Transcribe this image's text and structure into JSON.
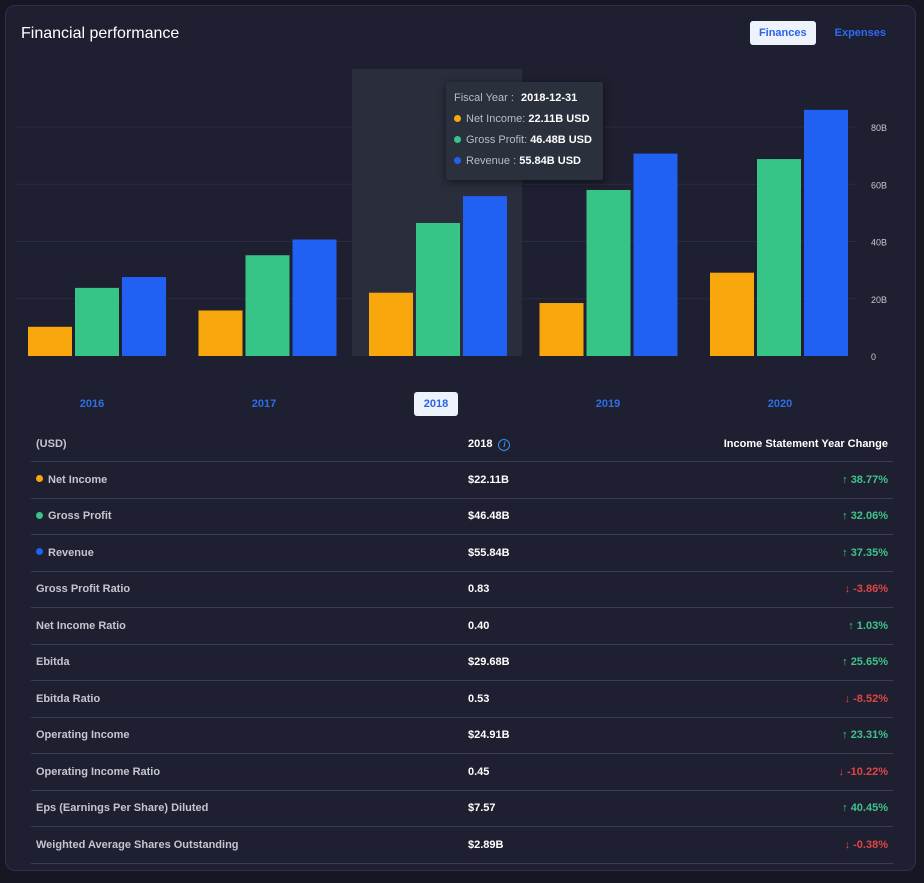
{
  "header": {
    "title": "Financial performance",
    "tabs": [
      "Finances",
      "Expenses"
    ]
  },
  "colors": {
    "net_income": "#f8a80d",
    "gross_profit": "#37c587",
    "revenue": "#2060f2"
  },
  "chart_data": {
    "type": "bar",
    "categories": [
      "2016",
      "2017",
      "2018",
      "2019",
      "2020"
    ],
    "series": [
      {
        "name": "Net Income",
        "values": [
          10.2,
          15.9,
          22.11,
          18.5,
          29.1
        ]
      },
      {
        "name": "Gross Profit",
        "values": [
          23.8,
          35.2,
          46.48,
          58.0,
          68.8
        ]
      },
      {
        "name": "Revenue",
        "values": [
          27.6,
          40.7,
          55.84,
          70.7,
          86.0
        ]
      }
    ],
    "yticks": [
      "0",
      "20B",
      "40B",
      "60B",
      "80B"
    ],
    "ylim": [
      0,
      90
    ],
    "highlighted": "2018"
  },
  "tooltip": {
    "fiscal_label": "Fiscal Year :",
    "fiscal_value": "2018-12-31",
    "rows": [
      {
        "label": "Net Income:",
        "value": "22.11B USD"
      },
      {
        "label": "Gross Profit:",
        "value": "46.48B USD"
      },
      {
        "label": "Revenue :",
        "value": "55.84B USD"
      }
    ]
  },
  "table": {
    "headers": {
      "unit": "(USD)",
      "year": "2018",
      "change": "Income Statement Year Change"
    },
    "rows": [
      {
        "label": "Net Income",
        "value": "$22.11B",
        "change": "38.77%",
        "dir": "up",
        "dot": "#f8a80d"
      },
      {
        "label": "Gross Profit",
        "value": "$46.48B",
        "change": "32.06%",
        "dir": "up",
        "dot": "#37c587"
      },
      {
        "label": "Revenue",
        "value": "$55.84B",
        "change": "37.35%",
        "dir": "up",
        "dot": "#2060f2"
      },
      {
        "label": "Gross Profit Ratio",
        "value": "0.83",
        "change": "-3.86%",
        "dir": "down"
      },
      {
        "label": "Net Income Ratio",
        "value": "0.40",
        "change": "1.03%",
        "dir": "up"
      },
      {
        "label": "Ebitda",
        "value": "$29.68B",
        "change": "25.65%",
        "dir": "up"
      },
      {
        "label": "Ebitda Ratio",
        "value": "0.53",
        "change": "-8.52%",
        "dir": "down"
      },
      {
        "label": "Operating Income",
        "value": "$24.91B",
        "change": "23.31%",
        "dir": "up"
      },
      {
        "label": "Operating Income Ratio",
        "value": "0.45",
        "change": "-10.22%",
        "dir": "down"
      },
      {
        "label": "Eps (Earnings Per Share) Diluted",
        "value": "$7.57",
        "change": "40.45%",
        "dir": "up"
      },
      {
        "label": "Weighted Average Shares Outstanding",
        "value": "$2.89B",
        "change": "-0.38%",
        "dir": "down"
      }
    ]
  }
}
